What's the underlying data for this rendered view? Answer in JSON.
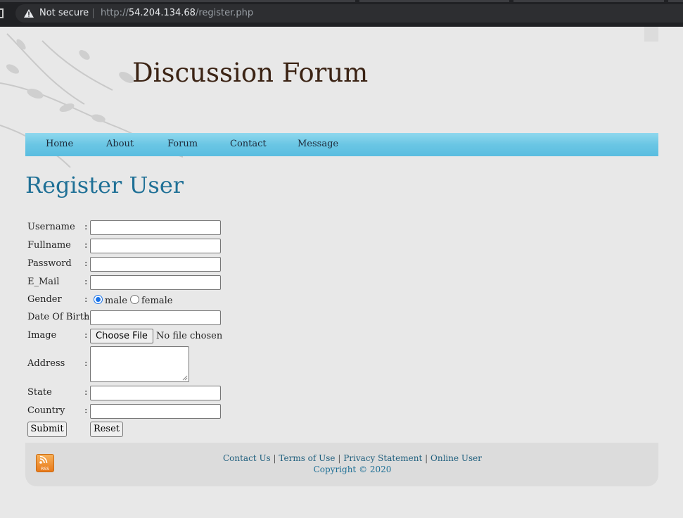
{
  "browser": {
    "security_label": "Not secure",
    "url_scheme": "http://",
    "url_host": "54.204.134.68",
    "url_path": "/register.php"
  },
  "site": {
    "title": "Discussion Forum"
  },
  "nav": {
    "items": [
      "Home",
      "About",
      "Forum",
      "Contact",
      "Message"
    ]
  },
  "page": {
    "heading": "Register User"
  },
  "form": {
    "separator": ":",
    "labels": {
      "username": "Username",
      "fullname": "Fullname",
      "password": "Password",
      "email": "E_Mail",
      "gender": "Gender",
      "dob": "Date Of Birth",
      "image": "Image",
      "address": "Address",
      "state": "State",
      "country": "Country"
    },
    "gender_options": [
      "male",
      "female"
    ],
    "gender_selected": "male",
    "file_button": "Choose File",
    "file_status": "No file chosen",
    "submit_label": "Submit",
    "reset_label": "Reset"
  },
  "footer": {
    "links": [
      "Contact Us",
      "Terms of Use",
      "Privacy Statement",
      "Online User"
    ],
    "divider": "|",
    "copyright": "Copyright © 2020",
    "rss_text": "RSS"
  },
  "colors": {
    "title": "#3b2314",
    "heading": "#1f7096",
    "nav": "#6ac6e4",
    "rss": "#e8791a"
  }
}
